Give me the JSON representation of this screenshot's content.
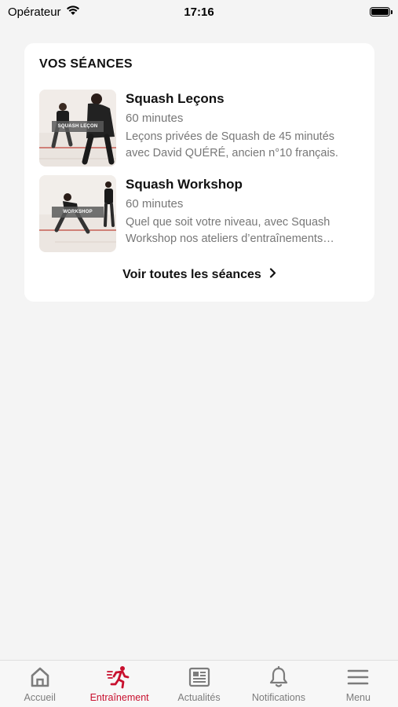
{
  "status_bar": {
    "carrier": "Opérateur",
    "time": "17:16"
  },
  "sessions_card": {
    "title": "VOS SÉANCES",
    "sessions": [
      {
        "name": "Squash Leçons",
        "duration": "60 minutes",
        "description": "Leçons privées de Squash de 45 minutés avec David QUÉRÉ, ancien n°10 français.",
        "thumbnail_label": "SQUASH LEÇON"
      },
      {
        "name": "Squash Workshop",
        "duration": "60 minutes",
        "description": "Quel que soit votre niveau, avec Squash Workshop nos ateliers d’entraînements…",
        "thumbnail_label": "WORKSHOP"
      }
    ],
    "see_all_label": "Voir toutes les séances"
  },
  "tab_bar": {
    "tabs": [
      {
        "label": "Accueil",
        "icon": "home-icon"
      },
      {
        "label": "Entraînement",
        "icon": "running-icon",
        "active": true
      },
      {
        "label": "Actualités",
        "icon": "newspaper-icon"
      },
      {
        "label": "Notifications",
        "icon": "bell-icon"
      },
      {
        "label": "Menu",
        "icon": "hamburger-menu-icon"
      }
    ]
  },
  "colors": {
    "accent": "#c8102e",
    "background": "#f4f4f4",
    "card": "#ffffff",
    "inactive_tab": "#7c7c7c"
  }
}
